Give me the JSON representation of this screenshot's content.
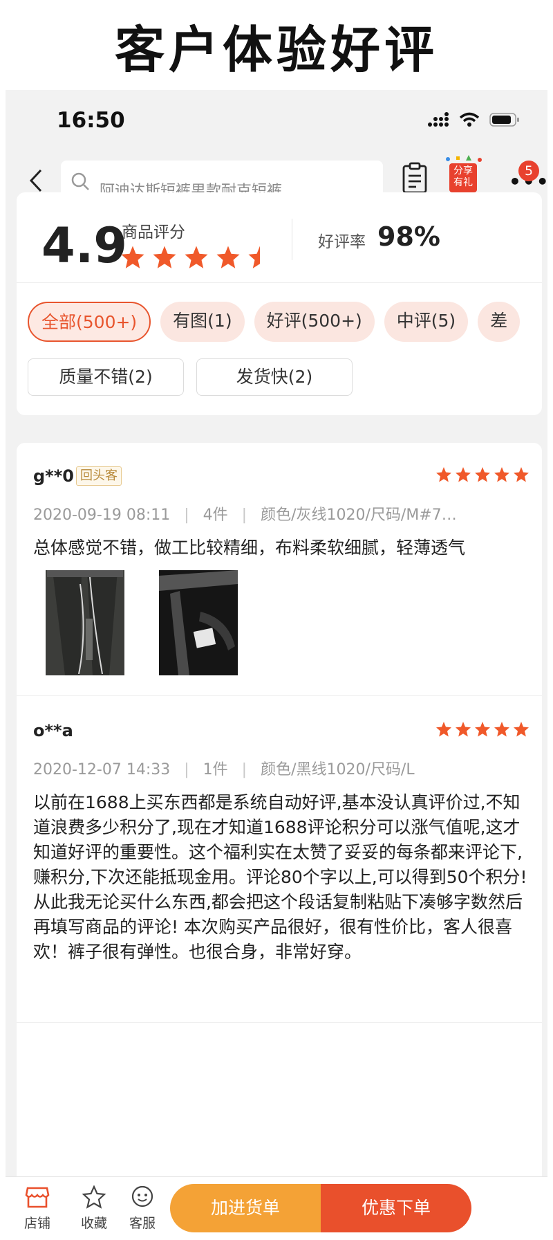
{
  "banner": {
    "title": "客户体验好评"
  },
  "status_bar": {
    "time": "16:50"
  },
  "nav": {
    "search_placeholder": "阿迪达斯短裤男款耐克短裤",
    "share_label": "分享有礼",
    "more_badge": "5"
  },
  "rating": {
    "score": "4.9",
    "score_label": "商品评分",
    "stars": 4.5,
    "rate_label": "好评率",
    "rate_value": "98%"
  },
  "filter_tags": [
    {
      "label": "全部(500+)",
      "active": true
    },
    {
      "label": "有图(1)"
    },
    {
      "label": "好评(500+)"
    },
    {
      "label": "中评(5)"
    },
    {
      "label": "差"
    }
  ],
  "keyword_tags": [
    "质量不错(2)",
    "发货快(2)"
  ],
  "reviews": [
    {
      "user": "g**0",
      "badge": "回头客",
      "stars": 5,
      "date": "2020-09-19 08:11",
      "qty": "4件",
      "spec": "颜色/灰线1020/尺码/M#7…",
      "text": "总体感觉不错，做工比较精细，布料柔软细腻，轻薄透气"
    },
    {
      "user": "o**a",
      "stars": 5,
      "date": "2020-12-07 14:33",
      "qty": "1件",
      "spec": "颜色/黑线1020/尺码/L",
      "text": "以前在1688上买东西都是系统自动好评,基本没认真评价过,不知道浪费多少积分了,现在才知道1688评论积分可以涨气值呢,这才知道好评的重要性。这个福利实在太赞了妥妥的每条都来评论下,赚积分,下次还能抵现金用。评论80个字以上,可以得到50个积分!从此我无论买什么东西,都会把这个段话复制粘贴下凑够字数然后再填写商品的评论! 本次购买产品很好，很有性价比，客人很喜欢！裤子很有弹性。也很合身，非常好穿。"
    }
  ],
  "bottom_bar": {
    "shop": "店铺",
    "favorite": "收藏",
    "service": "客服",
    "add_cart": "加进货单",
    "buy": "优惠下单"
  },
  "colors": {
    "accent": "#e9502c",
    "orange": "#f4a236",
    "star": "#f0592a"
  }
}
